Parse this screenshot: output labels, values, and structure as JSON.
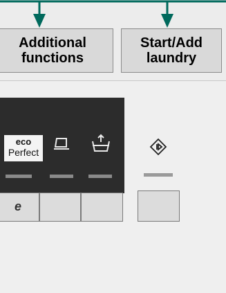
{
  "header": {
    "additional_functions_label": "Additional\nfunctions",
    "start_add_laundry_label": "Start/Add\nlaundry"
  },
  "display": {
    "eco_perfect_line1": "eco",
    "eco_perfect_line2": "Perfect",
    "eco_button_glyph": "e"
  },
  "icons": {
    "eco_perfect": "eco-perfect-icon",
    "iron": "iron-icon",
    "rinse": "rinse-icon",
    "start": "start-icon"
  },
  "colors": {
    "accent_green": "#00695c",
    "display_bg": "#2c2c2c",
    "indicator": "#8a8a8a",
    "button": "#dcdcdc"
  }
}
